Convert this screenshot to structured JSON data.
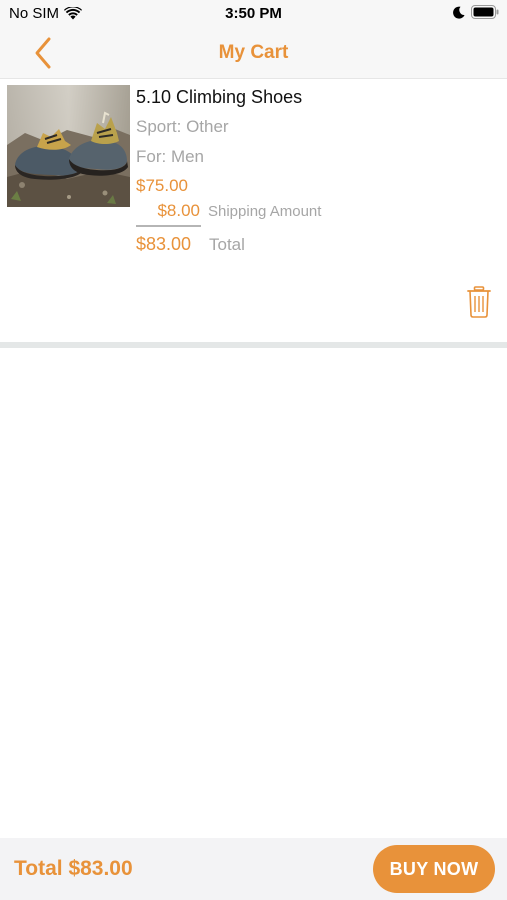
{
  "status_bar": {
    "carrier": "No SIM",
    "time": "3:50 PM"
  },
  "nav": {
    "title": "My Cart",
    "back_icon": "chevron-left-icon"
  },
  "cart_items": [
    {
      "name": "5.10 Climbing Shoes",
      "sport": "Sport: Other",
      "for": "For: Men",
      "price": "$75.00",
      "shipping_amount": "$8.00",
      "shipping_label": "Shipping Amount",
      "total_amount": "$83.00",
      "total_label": "Total",
      "delete_icon": "trash-icon"
    }
  ],
  "footer": {
    "total": "Total $83.00",
    "buy_button": "BUY NOW"
  },
  "colors": {
    "accent": "#e8923a",
    "secondary_text": "#a6a6a6",
    "bar_background": "#f7f7f7"
  }
}
